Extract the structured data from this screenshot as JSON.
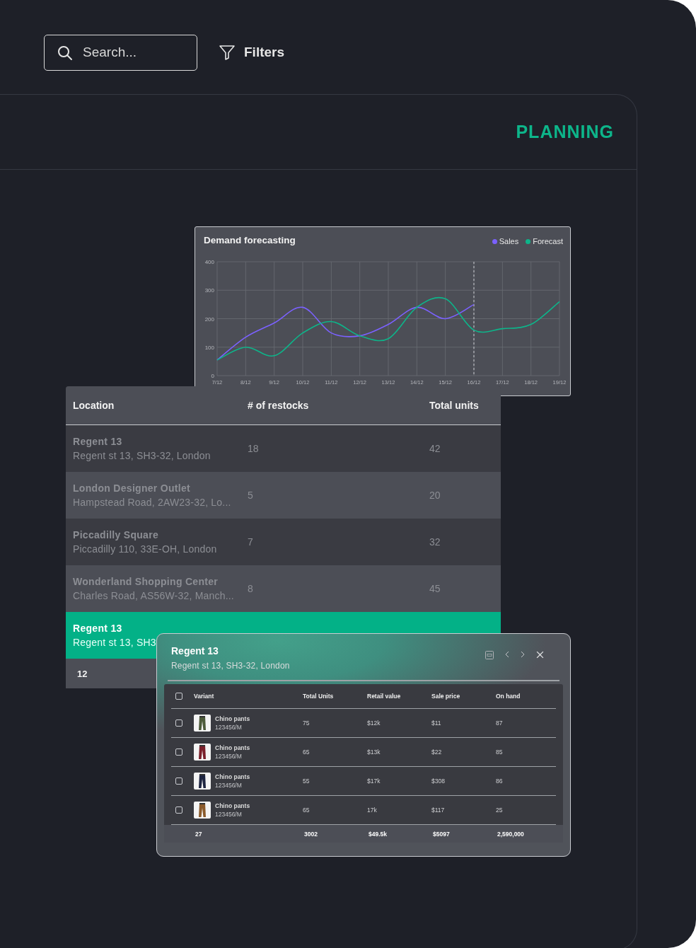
{
  "search": {
    "placeholder": "Search..."
  },
  "filters": {
    "label": "Filters"
  },
  "panel": {
    "title": "PLANNING"
  },
  "demand_chart": {
    "chart_data": {
      "type": "line",
      "grid": true,
      "title": "Demand forecasting",
      "categories": [
        "7/12",
        "8/12",
        "9/12",
        "10/12",
        "11/12",
        "12/12",
        "13/12",
        "14/12",
        "15/12",
        "16/12",
        "17/12",
        "18/12",
        "19/12"
      ],
      "ylim": [
        0,
        400
      ],
      "yticks": [
        0,
        100,
        200,
        300,
        400
      ],
      "series": [
        {
          "name": "Sales",
          "color": "#7b61ff",
          "values": [
            55,
            135,
            185,
            240,
            150,
            140,
            180,
            240,
            200,
            250,
            null,
            null,
            null
          ]
        },
        {
          "name": "Forecast",
          "color": "#0db58a",
          "values": [
            55,
            100,
            70,
            150,
            190,
            140,
            130,
            240,
            270,
            160,
            165,
            180,
            260
          ]
        }
      ],
      "ref_lines": [
        {
          "axis": "x",
          "value": "16/12"
        }
      ]
    }
  },
  "locations_table": {
    "columns": [
      "Location",
      "# of restocks",
      "Total units"
    ],
    "rows": [
      {
        "name": "Regent 13",
        "address": "Regent st 13, SH3-32, London",
        "restocks": "18",
        "units": "42",
        "selected": false
      },
      {
        "name": "London Designer Outlet",
        "address": "Hampstead Road, 2AW23-32, Lo...",
        "restocks": "5",
        "units": "20",
        "selected": false
      },
      {
        "name": "Piccadilly Square",
        "address": "Piccadilly 110, 33E-OH, London",
        "restocks": "7",
        "units": "32",
        "selected": false
      },
      {
        "name": "Wonderland Shopping Center",
        "address": "Charles Road, AS56W-32, Manch...",
        "restocks": "8",
        "units": "45",
        "selected": false
      },
      {
        "name": "Regent 13",
        "address": "Regent st 13, SH3",
        "selected": true
      }
    ],
    "footer": "12"
  },
  "detail_popup": {
    "title": "Regent 13",
    "subtitle": "Regent st 13, SH3-32, London",
    "select_all": {
      "checked": false
    },
    "columns": [
      "Variant",
      "Total Units",
      "Retail value",
      "Sale price",
      "On hand"
    ],
    "rows": [
      {
        "checked": false,
        "name": "Chino pants",
        "sku": "123456/M",
        "units": "75",
        "retail": "$12k",
        "price": "$11",
        "on_hand": "87"
      },
      {
        "checked": false,
        "name": "Chino pants",
        "sku": "123456/M",
        "units": "65",
        "retail": "$13k",
        "price": "$22",
        "on_hand": "85"
      },
      {
        "checked": false,
        "name": "Chino pants",
        "sku": "123456/M",
        "units": "55",
        "retail": "$17k",
        "price": "$308",
        "on_hand": "86"
      },
      {
        "checked": false,
        "name": "Chino pants",
        "sku": "123456/M",
        "units": "65",
        "retail": "17k",
        "price": "$117",
        "on_hand": "25"
      }
    ],
    "totals": [
      "27",
      "3002",
      "$49.5k",
      "$5097",
      "2,590,000"
    ]
  }
}
